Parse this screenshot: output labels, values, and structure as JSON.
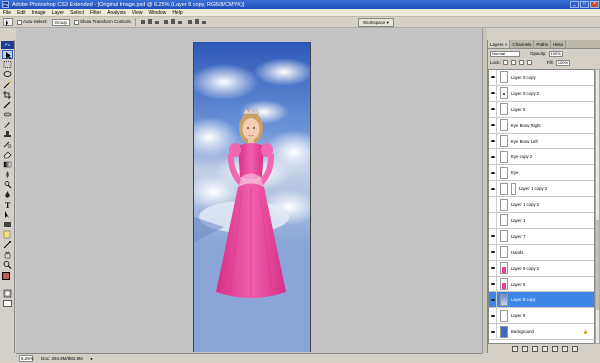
{
  "window": {
    "title": "Adobe Photoshop CS3 Extended - [Original Image.psd @ 6.25% (Layer 8 copy, RGB/8/CMYK)]",
    "logo": "Ps"
  },
  "menu": [
    "File",
    "Edit",
    "Image",
    "Layer",
    "Select",
    "Filter",
    "Analysis",
    "View",
    "Window",
    "Help"
  ],
  "options": {
    "auto_select_label": "Auto-Select:",
    "auto_select_value": "Group",
    "show_transform_label": "Show Transform Controls",
    "workspace_label": "Workspace ▾"
  },
  "toolbox": {
    "badge": "Ps",
    "foreground_color": "#c45a55",
    "background_color": "#f0f0f0"
  },
  "status": {
    "zoom": "6.25%",
    "doc": "Doc: 294.9M/882.9M"
  },
  "panel": {
    "tabs": [
      "Layers ×",
      "Channels",
      "Paths",
      "Histo"
    ],
    "blend_mode": "Normal",
    "opacity_label": "Opacity:",
    "opacity_value": "100%",
    "lock_label": "Lock:",
    "fill_label": "Fill:",
    "fill_value": "100%"
  },
  "layers": [
    {
      "name": "Layer 9 copy",
      "thumb": "plain",
      "visible": true
    },
    {
      "name": "Layer 9 copy 2",
      "thumb": "dot",
      "visible": true
    },
    {
      "name": "Layer 5",
      "thumb": "plain",
      "visible": true
    },
    {
      "name": "Eye Brow Right",
      "thumb": "plain",
      "visible": true
    },
    {
      "name": "Eye Brow Left",
      "thumb": "plain",
      "visible": true
    },
    {
      "name": "Eye copy 2",
      "thumb": "plain",
      "visible": true
    },
    {
      "name": "Eye",
      "thumb": "plain",
      "visible": true
    },
    {
      "name": "Layer 1 copy 3",
      "thumb": "plain",
      "visible": true
    },
    {
      "name": "Layer 1 copy 2",
      "thumb": "plain",
      "visible": false
    },
    {
      "name": "Layer 1",
      "thumb": "plain",
      "visible": false
    },
    {
      "name": "Layer 7",
      "thumb": "plain",
      "visible": true
    },
    {
      "name": "Hands",
      "thumb": "plain",
      "visible": true
    },
    {
      "name": "Layer 8 copy 2",
      "thumb": "pink",
      "visible": true
    },
    {
      "name": "Layer 6",
      "thumb": "pink",
      "visible": true
    },
    {
      "name": "Layer 8 copy",
      "thumb": "sky",
      "visible": true
    },
    {
      "name": "Layer 8",
      "thumb": "plain",
      "visible": true
    },
    {
      "name": "Background",
      "thumb": "blue",
      "visible": true
    }
  ],
  "selected_layer_name": "Layer 8 copy",
  "colors": {
    "selection": "#3d86e6",
    "sky": "#5e7fc8",
    "dress": "#e8409a"
  }
}
